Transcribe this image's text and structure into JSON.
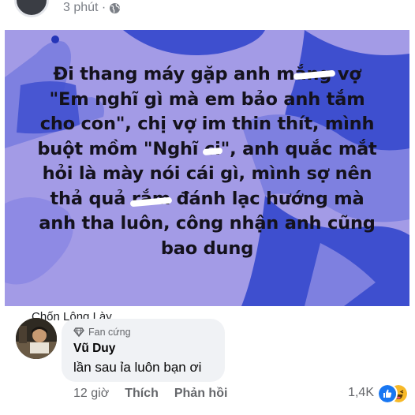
{
  "post": {
    "time": "3 phút ·",
    "image_text": {
      "line1": "Đi thang máy gặp anh m",
      "line1_scribbled": "ắng",
      "line1_end": " vợ",
      "line2": "\"Em nghĩ gì mà em bảo anh tắm",
      "line3": "cho con\", chị vợ im thin thít, mình",
      "line4a": "buột mồm \"Nghĩ ",
      "line4_scribbled": "ci",
      "line4b": "\", anh quắc mắt",
      "line5": "hỏi là mày nói cái gì, mình sợ nên",
      "line6a": "thả quả ",
      "line6_scribbled": "rắm",
      "line6b": " đánh lạc hướng mà",
      "line7": "anh tha luôn, công nhận anh cũng",
      "line8": "bao dung"
    },
    "colors": {
      "image_bg": "#a39be6",
      "shape_dark": "#3e4fcf",
      "shape_mid": "#7e80e0"
    }
  },
  "comment": {
    "page_name": "Chốn Lông Lày",
    "badge": "Fan cứng",
    "author": "Vũ Duy",
    "text": "lần sau ỉa luôn bạn ơi",
    "time": "12 giờ",
    "like_label": "Thích",
    "reply_label": "Phản hồi",
    "reaction_count": "1,4K",
    "reaction_icons": [
      "like-icon",
      "haha-icon"
    ]
  }
}
